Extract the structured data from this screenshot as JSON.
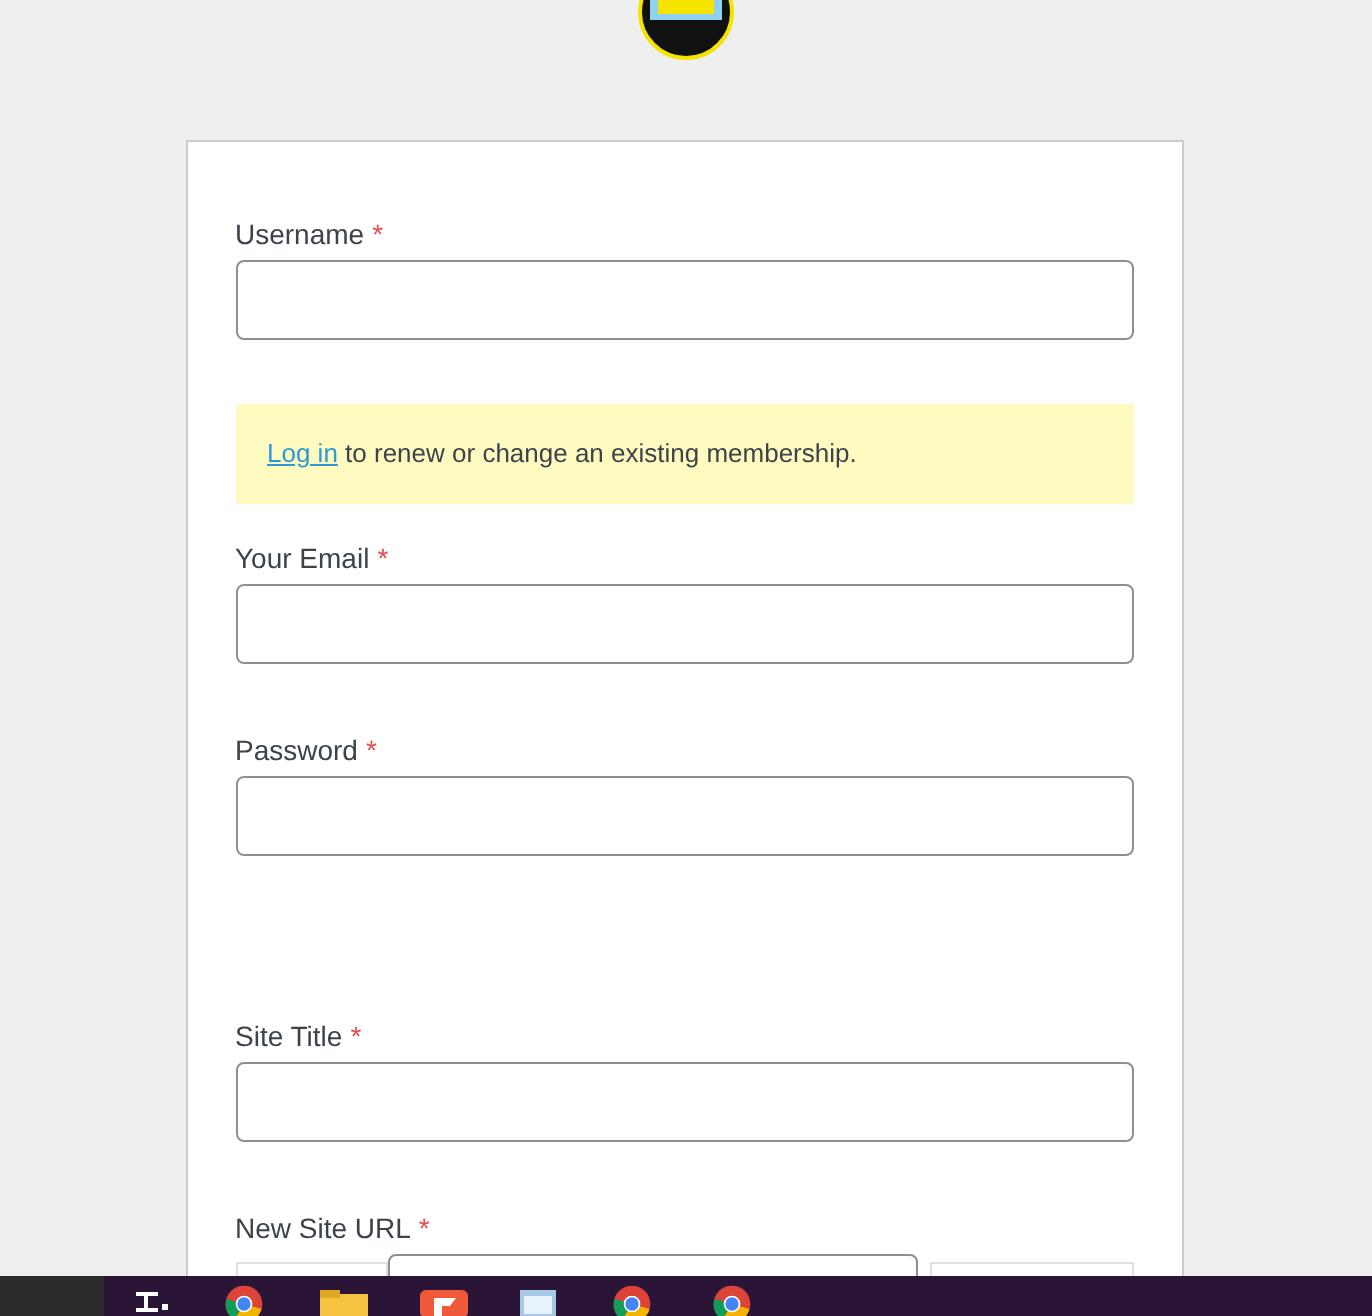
{
  "form": {
    "items": [
      {
        "kind": "field",
        "label": "Username",
        "required_mark": "*"
      },
      {
        "kind": "notice",
        "link": "Log in",
        "text": "to renew or change an existing membership."
      },
      {
        "kind": "field",
        "label": "Your Email",
        "required_mark": "*"
      },
      {
        "kind": "field",
        "label": "Password",
        "required_mark": "*"
      },
      {
        "kind": "field",
        "label": "Site Title",
        "required_mark": "*"
      },
      {
        "kind": "url",
        "label": "New Site URL",
        "required_mark": "*"
      }
    ]
  }
}
